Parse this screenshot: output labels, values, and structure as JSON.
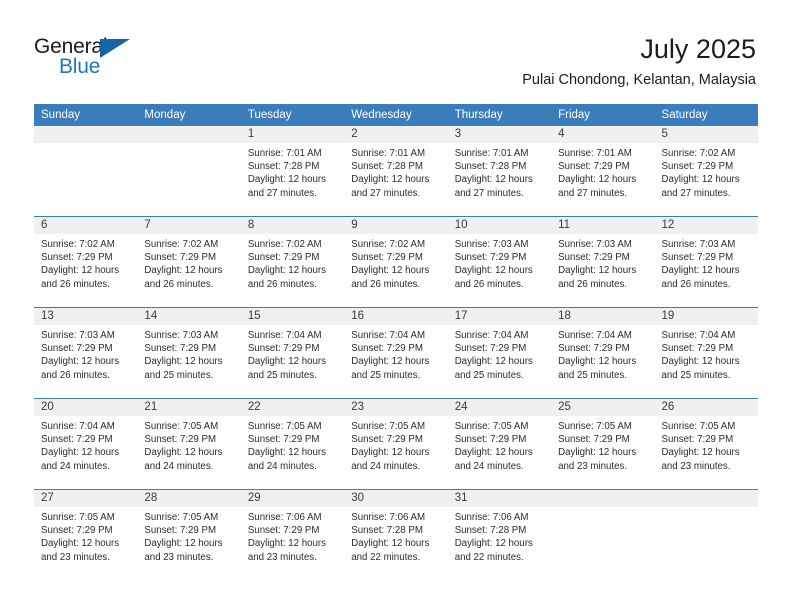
{
  "brand": {
    "word_one": "General",
    "word_two": "Blue",
    "triangle_icon": "triangle-icon",
    "accent_color": "#2077bd",
    "triangle_color": "#1565a8"
  },
  "header": {
    "title": "July 2025",
    "subtitle": "Pulai Chondong, Kelantan, Malaysia"
  },
  "theme": {
    "header_row_bg": "#3b7cba",
    "daynum_band_bg": "#f0f0f0",
    "text_color": "#2c2c2c"
  },
  "weekdays": [
    "Sunday",
    "Monday",
    "Tuesday",
    "Wednesday",
    "Thursday",
    "Friday",
    "Saturday"
  ],
  "labels": {
    "sunrise_prefix": "Sunrise:",
    "sunset_prefix": "Sunset:",
    "daylight_prefix": "Daylight:"
  },
  "weeks": [
    [
      {
        "day": "",
        "sunrise": "",
        "sunset": "",
        "daylight_line1": "",
        "daylight_line2": ""
      },
      {
        "day": "",
        "sunrise": "",
        "sunset": "",
        "daylight_line1": "",
        "daylight_line2": ""
      },
      {
        "day": "1",
        "sunrise": "Sunrise: 7:01 AM",
        "sunset": "Sunset: 7:28 PM",
        "daylight_line1": "Daylight: 12 hours",
        "daylight_line2": "and 27 minutes."
      },
      {
        "day": "2",
        "sunrise": "Sunrise: 7:01 AM",
        "sunset": "Sunset: 7:28 PM",
        "daylight_line1": "Daylight: 12 hours",
        "daylight_line2": "and 27 minutes."
      },
      {
        "day": "3",
        "sunrise": "Sunrise: 7:01 AM",
        "sunset": "Sunset: 7:28 PM",
        "daylight_line1": "Daylight: 12 hours",
        "daylight_line2": "and 27 minutes."
      },
      {
        "day": "4",
        "sunrise": "Sunrise: 7:01 AM",
        "sunset": "Sunset: 7:29 PM",
        "daylight_line1": "Daylight: 12 hours",
        "daylight_line2": "and 27 minutes."
      },
      {
        "day": "5",
        "sunrise": "Sunrise: 7:02 AM",
        "sunset": "Sunset: 7:29 PM",
        "daylight_line1": "Daylight: 12 hours",
        "daylight_line2": "and 27 minutes."
      }
    ],
    [
      {
        "day": "6",
        "sunrise": "Sunrise: 7:02 AM",
        "sunset": "Sunset: 7:29 PM",
        "daylight_line1": "Daylight: 12 hours",
        "daylight_line2": "and 26 minutes."
      },
      {
        "day": "7",
        "sunrise": "Sunrise: 7:02 AM",
        "sunset": "Sunset: 7:29 PM",
        "daylight_line1": "Daylight: 12 hours",
        "daylight_line2": "and 26 minutes."
      },
      {
        "day": "8",
        "sunrise": "Sunrise: 7:02 AM",
        "sunset": "Sunset: 7:29 PM",
        "daylight_line1": "Daylight: 12 hours",
        "daylight_line2": "and 26 minutes."
      },
      {
        "day": "9",
        "sunrise": "Sunrise: 7:02 AM",
        "sunset": "Sunset: 7:29 PM",
        "daylight_line1": "Daylight: 12 hours",
        "daylight_line2": "and 26 minutes."
      },
      {
        "day": "10",
        "sunrise": "Sunrise: 7:03 AM",
        "sunset": "Sunset: 7:29 PM",
        "daylight_line1": "Daylight: 12 hours",
        "daylight_line2": "and 26 minutes."
      },
      {
        "day": "11",
        "sunrise": "Sunrise: 7:03 AM",
        "sunset": "Sunset: 7:29 PM",
        "daylight_line1": "Daylight: 12 hours",
        "daylight_line2": "and 26 minutes."
      },
      {
        "day": "12",
        "sunrise": "Sunrise: 7:03 AM",
        "sunset": "Sunset: 7:29 PM",
        "daylight_line1": "Daylight: 12 hours",
        "daylight_line2": "and 26 minutes."
      }
    ],
    [
      {
        "day": "13",
        "sunrise": "Sunrise: 7:03 AM",
        "sunset": "Sunset: 7:29 PM",
        "daylight_line1": "Daylight: 12 hours",
        "daylight_line2": "and 26 minutes."
      },
      {
        "day": "14",
        "sunrise": "Sunrise: 7:03 AM",
        "sunset": "Sunset: 7:29 PM",
        "daylight_line1": "Daylight: 12 hours",
        "daylight_line2": "and 25 minutes."
      },
      {
        "day": "15",
        "sunrise": "Sunrise: 7:04 AM",
        "sunset": "Sunset: 7:29 PM",
        "daylight_line1": "Daylight: 12 hours",
        "daylight_line2": "and 25 minutes."
      },
      {
        "day": "16",
        "sunrise": "Sunrise: 7:04 AM",
        "sunset": "Sunset: 7:29 PM",
        "daylight_line1": "Daylight: 12 hours",
        "daylight_line2": "and 25 minutes."
      },
      {
        "day": "17",
        "sunrise": "Sunrise: 7:04 AM",
        "sunset": "Sunset: 7:29 PM",
        "daylight_line1": "Daylight: 12 hours",
        "daylight_line2": "and 25 minutes."
      },
      {
        "day": "18",
        "sunrise": "Sunrise: 7:04 AM",
        "sunset": "Sunset: 7:29 PM",
        "daylight_line1": "Daylight: 12 hours",
        "daylight_line2": "and 25 minutes."
      },
      {
        "day": "19",
        "sunrise": "Sunrise: 7:04 AM",
        "sunset": "Sunset: 7:29 PM",
        "daylight_line1": "Daylight: 12 hours",
        "daylight_line2": "and 25 minutes."
      }
    ],
    [
      {
        "day": "20",
        "sunrise": "Sunrise: 7:04 AM",
        "sunset": "Sunset: 7:29 PM",
        "daylight_line1": "Daylight: 12 hours",
        "daylight_line2": "and 24 minutes."
      },
      {
        "day": "21",
        "sunrise": "Sunrise: 7:05 AM",
        "sunset": "Sunset: 7:29 PM",
        "daylight_line1": "Daylight: 12 hours",
        "daylight_line2": "and 24 minutes."
      },
      {
        "day": "22",
        "sunrise": "Sunrise: 7:05 AM",
        "sunset": "Sunset: 7:29 PM",
        "daylight_line1": "Daylight: 12 hours",
        "daylight_line2": "and 24 minutes."
      },
      {
        "day": "23",
        "sunrise": "Sunrise: 7:05 AM",
        "sunset": "Sunset: 7:29 PM",
        "daylight_line1": "Daylight: 12 hours",
        "daylight_line2": "and 24 minutes."
      },
      {
        "day": "24",
        "sunrise": "Sunrise: 7:05 AM",
        "sunset": "Sunset: 7:29 PM",
        "daylight_line1": "Daylight: 12 hours",
        "daylight_line2": "and 24 minutes."
      },
      {
        "day": "25",
        "sunrise": "Sunrise: 7:05 AM",
        "sunset": "Sunset: 7:29 PM",
        "daylight_line1": "Daylight: 12 hours",
        "daylight_line2": "and 23 minutes."
      },
      {
        "day": "26",
        "sunrise": "Sunrise: 7:05 AM",
        "sunset": "Sunset: 7:29 PM",
        "daylight_line1": "Daylight: 12 hours",
        "daylight_line2": "and 23 minutes."
      }
    ],
    [
      {
        "day": "27",
        "sunrise": "Sunrise: 7:05 AM",
        "sunset": "Sunset: 7:29 PM",
        "daylight_line1": "Daylight: 12 hours",
        "daylight_line2": "and 23 minutes."
      },
      {
        "day": "28",
        "sunrise": "Sunrise: 7:05 AM",
        "sunset": "Sunset: 7:29 PM",
        "daylight_line1": "Daylight: 12 hours",
        "daylight_line2": "and 23 minutes."
      },
      {
        "day": "29",
        "sunrise": "Sunrise: 7:06 AM",
        "sunset": "Sunset: 7:29 PM",
        "daylight_line1": "Daylight: 12 hours",
        "daylight_line2": "and 23 minutes."
      },
      {
        "day": "30",
        "sunrise": "Sunrise: 7:06 AM",
        "sunset": "Sunset: 7:28 PM",
        "daylight_line1": "Daylight: 12 hours",
        "daylight_line2": "and 22 minutes."
      },
      {
        "day": "31",
        "sunrise": "Sunrise: 7:06 AM",
        "sunset": "Sunset: 7:28 PM",
        "daylight_line1": "Daylight: 12 hours",
        "daylight_line2": "and 22 minutes."
      },
      {
        "day": "",
        "sunrise": "",
        "sunset": "",
        "daylight_line1": "",
        "daylight_line2": ""
      },
      {
        "day": "",
        "sunrise": "",
        "sunset": "",
        "daylight_line1": "",
        "daylight_line2": ""
      }
    ]
  ]
}
